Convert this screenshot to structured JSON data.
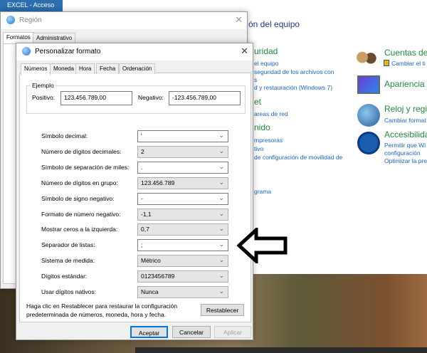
{
  "background": {
    "tile_label": "EXCEL - Acceso",
    "control_panel": {
      "title": "ón del equipo",
      "left": [
        {
          "h": "uridad"
        },
        {
          "l": "el equipo"
        },
        {
          "l": "seguridad de los archivos con"
        },
        {
          "l": "s"
        },
        {
          "l": "d y restauración (Windows 7)"
        },
        {
          "h": "et"
        },
        {
          "l": "areas de red"
        },
        {
          "h": "nido"
        },
        {
          "l": "mpresoras"
        },
        {
          "l": "tivo"
        },
        {
          "l": "de configuración de movilidad de"
        },
        {
          "l": "grama"
        }
      ],
      "right": [
        {
          "title": "Cuentas de u",
          "link": "Cambiar el ti",
          "icon": "users-icon"
        },
        {
          "title": "Apariencia y",
          "icon": "monitor-icon"
        },
        {
          "title": "Reloj y regió",
          "link": "Cambiar format",
          "icon": "clock-globe-icon"
        },
        {
          "title": "Accesibilidad",
          "link": "Permitir que Wi",
          "link2": "configuración",
          "link3": "Optimizar la pre",
          "icon": "accessibility-icon"
        }
      ]
    }
  },
  "region": {
    "title": "Región",
    "tabs": [
      "Formatos",
      "Administrativo"
    ]
  },
  "dialog": {
    "title": "Personalizar formato",
    "tabs": [
      "Números",
      "Moneda",
      "Hora",
      "Fecha",
      "Ordenación"
    ],
    "example": {
      "legend": "Ejemplo",
      "positive_label": "Positivo:",
      "positive_value": "123.456.789,00",
      "negative_label": "Negativo:",
      "negative_value": "-123.456.789,00"
    },
    "rows": [
      {
        "label": "Símbolo decimal:",
        "value": "'",
        "editable": true
      },
      {
        "label": "Número de dígitos decimales:",
        "value": "2"
      },
      {
        "label": "Símbolo de separación de miles:",
        "value": ".",
        "editable": true
      },
      {
        "label": "Número de dígitos en grupo:",
        "value": "123.456.789"
      },
      {
        "label": "Símbolo de signo negativo:",
        "value": "-",
        "editable": true
      },
      {
        "label": "Formato de número negativo:",
        "value": "-1,1"
      },
      {
        "label": "Mostrar ceros a la izquierda:",
        "value": "0,7"
      },
      {
        "label": "Separador de listas:",
        "value": ";",
        "editable": true
      },
      {
        "label": "Sistema de medida:",
        "value": "Métrico"
      },
      {
        "label": "Dígitos estándar:",
        "value": "0123456789"
      },
      {
        "label": "Usar dígitos nativos:",
        "value": "Nunca"
      }
    ],
    "reset_text_1": "Haga clic en Restablecer para restaurar la configuración",
    "reset_text_2": "predeterminada de números, moneda, hora y fecha.",
    "reset_button": "Restablecer",
    "ok": "Aceptar",
    "cancel": "Cancelar",
    "apply": "Aplicar"
  }
}
